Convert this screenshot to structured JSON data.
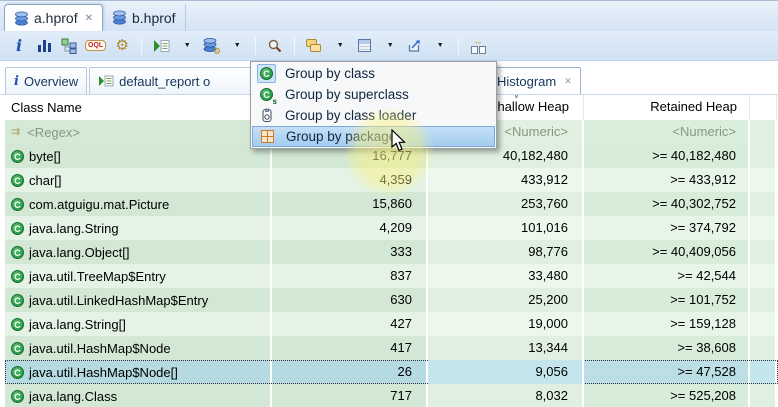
{
  "editor_tabs": [
    {
      "label": "a.hprof",
      "active": true,
      "closable": true
    },
    {
      "label": "b.hprof",
      "active": false,
      "closable": false
    }
  ],
  "toolbar": {
    "oql_label": "OQL",
    "buttons": [
      "overview-info",
      "histogram",
      "dominator-tree",
      "oql-query",
      "expert-system",
      "run-report",
      "heap-dump-actions",
      "search",
      "group-result-by",
      "calculator",
      "export",
      "compare-tables"
    ]
  },
  "view_tabs": [
    {
      "label": "Overview",
      "active": false
    },
    {
      "label": "default_report o",
      "active": false
    },
    {
      "label": "Histogram",
      "active": true,
      "closable": true
    }
  ],
  "context_menu": {
    "items": [
      {
        "label": "Group by class",
        "icon": "class-icon",
        "checked": true
      },
      {
        "label": "Group by superclass",
        "icon": "superclass-icon",
        "checked": false
      },
      {
        "label": "Group by class loader",
        "icon": "class-loader-icon",
        "checked": false
      },
      {
        "label": "Group by package",
        "icon": "package-icon",
        "highlighted": true
      }
    ]
  },
  "table": {
    "columns": {
      "class_name": "Class Name",
      "objects": "",
      "shallow": "Shallow Heap",
      "retained": "Retained Heap"
    },
    "sort": {
      "column": "shallow",
      "direction": "desc"
    },
    "filters": {
      "regex": "<Regex>",
      "numeric": "<Numeric>"
    },
    "rows": [
      {
        "name": "byte[]",
        "objects": "16,777",
        "shallow": "40,182,480",
        "retained": ">= 40,182,480",
        "selected": false
      },
      {
        "name": "char[]",
        "objects": "4,359",
        "shallow": "433,912",
        "retained": ">= 433,912",
        "selected": false
      },
      {
        "name": "com.atguigu.mat.Picture",
        "objects": "15,860",
        "shallow": "253,760",
        "retained": ">= 40,302,752",
        "selected": false
      },
      {
        "name": "java.lang.String",
        "objects": "4,209",
        "shallow": "101,016",
        "retained": ">= 374,792",
        "selected": false
      },
      {
        "name": "java.lang.Object[]",
        "objects": "333",
        "shallow": "98,776",
        "retained": ">= 40,409,056",
        "selected": false
      },
      {
        "name": "java.util.TreeMap$Entry",
        "objects": "837",
        "shallow": "33,480",
        "retained": ">= 42,544",
        "selected": false
      },
      {
        "name": "java.util.LinkedHashMap$Entry",
        "objects": "630",
        "shallow": "25,200",
        "retained": ">= 101,752",
        "selected": false
      },
      {
        "name": "java.lang.String[]",
        "objects": "427",
        "shallow": "19,000",
        "retained": ">= 159,128",
        "selected": false
      },
      {
        "name": "java.util.HashMap$Node",
        "objects": "417",
        "shallow": "13,344",
        "retained": ">= 38,608",
        "selected": false
      },
      {
        "name": "java.util.HashMap$Node[]",
        "objects": "26",
        "shallow": "9,056",
        "retained": ">= 47,528",
        "selected": true
      },
      {
        "name": "java.lang.Class",
        "objects": "717",
        "shallow": "8,032",
        "retained": ">= 525,208",
        "selected": false
      }
    ]
  },
  "glyphs": {
    "close": "✕",
    "dropdown": "▼",
    "class_letter": "C",
    "superclass_suffix": "s",
    "info": "i",
    "sort_caret": "˅",
    "filter_icon": "⇉",
    "gear": "⚙",
    "compare_arrows": "↔"
  },
  "colors": {
    "row_green_dark": "#d2e8d4",
    "row_green_light": "#e4f3e5",
    "selected_row_blue": "#b5dae2",
    "menu_highlight": "#a3cdf0",
    "tab_bar_blue": "#d4e3f4",
    "class_icon_green": "#1e8f3e",
    "package_icon_orange": "#c87a2a",
    "filter_text": "#85987f"
  }
}
